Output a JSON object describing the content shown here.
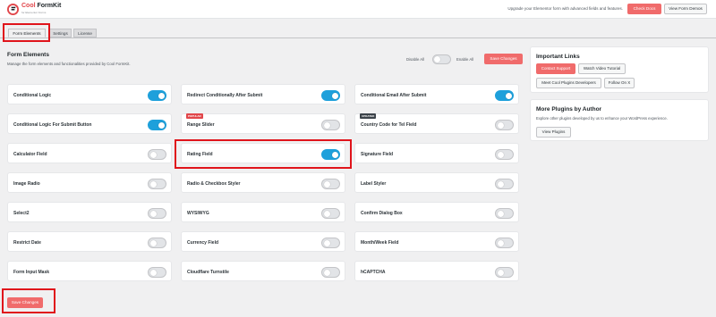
{
  "header": {
    "brand_name_accent": "Cool",
    "brand_name": " FormKit",
    "brand_sub": "for Elementor Forms",
    "upgrade_text": "Upgrade your Elementor form with advanced fields and features.",
    "check_docs": "Check Docs",
    "view_demos": "View Form Demos"
  },
  "tabs": [
    "Form Elements",
    "Settings",
    "License"
  ],
  "main": {
    "title": "Form Elements",
    "description": "Manage the form elements and functionalities provided by Cool FormKit.",
    "disable_all": "Disable All",
    "enable_all": "Enable All",
    "save_label": "Save Changes",
    "master_enabled": false
  },
  "elements": [
    {
      "label": "Conditional Logic",
      "enabled": true,
      "badge": ""
    },
    {
      "label": "Redirect Conditionally After Submit",
      "enabled": true,
      "badge": ""
    },
    {
      "label": "Conditional Email After Submit",
      "enabled": true,
      "badge": ""
    },
    {
      "label": "Conditional Logic For Submit Button",
      "enabled": true,
      "badge": ""
    },
    {
      "label": "Range Slider",
      "enabled": false,
      "badge": "POPULAR"
    },
    {
      "label": "Country Code for Tel Field",
      "enabled": false,
      "badge": "UPDATED"
    },
    {
      "label": "Calculator Field",
      "enabled": false,
      "badge": ""
    },
    {
      "label": "Rating Field",
      "enabled": true,
      "badge": ""
    },
    {
      "label": "Signature Field",
      "enabled": false,
      "badge": ""
    },
    {
      "label": "Image Radio",
      "enabled": false,
      "badge": ""
    },
    {
      "label": "Radio & Checkbox Styler",
      "enabled": false,
      "badge": ""
    },
    {
      "label": "Label Styler",
      "enabled": false,
      "badge": ""
    },
    {
      "label": "Select2",
      "enabled": false,
      "badge": ""
    },
    {
      "label": "WYSIWYG",
      "enabled": false,
      "badge": ""
    },
    {
      "label": "Confirm Dialog Box",
      "enabled": false,
      "badge": ""
    },
    {
      "label": "Restrict Date",
      "enabled": false,
      "badge": ""
    },
    {
      "label": "Currency Field",
      "enabled": false,
      "badge": ""
    },
    {
      "label": "Month/Week Field",
      "enabled": false,
      "badge": ""
    },
    {
      "label": "Form Input Mask",
      "enabled": false,
      "badge": ""
    },
    {
      "label": "Cloudflare Turnstile",
      "enabled": false,
      "badge": ""
    },
    {
      "label": "hCAPTCHA",
      "enabled": false,
      "badge": ""
    }
  ],
  "sidebar": {
    "links_title": "Important Links",
    "contact_support": "Contact Support",
    "video_tutorial": "Watch Video Tutorial",
    "meet_developers": "Meet Cool Plugins Developers",
    "follow_x": "Follow On X",
    "plugins_title": "More Plugins by Author",
    "plugins_desc": "Explore other plugins developed by us to enhance your WordPress experience.",
    "view_plugins": "View Plugins"
  },
  "colors": {
    "accent": "#f06b6b",
    "toggle_on": "#1ea0db",
    "highlight": "#e0141b"
  }
}
